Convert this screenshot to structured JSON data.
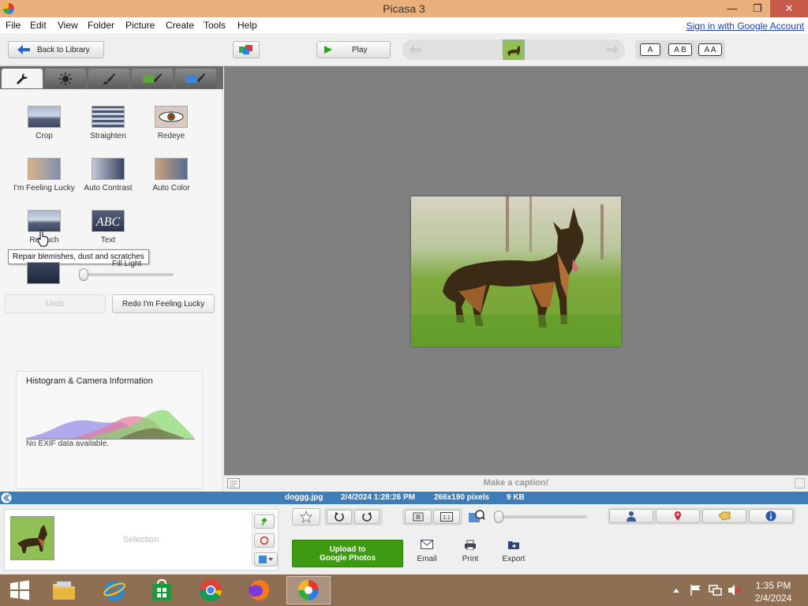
{
  "window": {
    "title": "Picasa 3",
    "minimize": "—",
    "restore": "❐",
    "close": "✕"
  },
  "menu": [
    "File",
    "Edit",
    "View",
    "Folder",
    "Picture",
    "Create",
    "Tools",
    "Help"
  ],
  "signin": "Sign in with Google Account",
  "toolbar": {
    "back_label": "Back to Library",
    "play_label": "Play",
    "font_buttons": [
      "A",
      "A B",
      "A A"
    ]
  },
  "tools": [
    {
      "label": "Crop"
    },
    {
      "label": "Straighten"
    },
    {
      "label": "Redeye"
    },
    {
      "label": "I'm Feeling Lucky"
    },
    {
      "label": "Auto Contrast"
    },
    {
      "label": "Auto Color"
    },
    {
      "label": "Retouch"
    },
    {
      "label": "Text"
    }
  ],
  "tooltip": "Repair blemishes, dust and scratches",
  "fill_light": {
    "label": "Fill Light",
    "value": 0
  },
  "buttons": {
    "undo": "Undo",
    "redo": "Redo I'm Feeling Lucky"
  },
  "histogram": {
    "title": "Histogram & Camera Information",
    "exif": "No EXIF data available."
  },
  "caption": {
    "placeholder": "Make a caption!"
  },
  "info": {
    "filename": "doggg.jpg",
    "datetime": "2/4/2024 1:28:26 PM",
    "dimensions": "266x190 pixels",
    "size": "9 KB"
  },
  "tray": {
    "selection": "Selection",
    "upload": "Upload to Google Photos",
    "email": "Email",
    "print": "Print",
    "export": "Export"
  },
  "clock": {
    "time": "1:35 PM",
    "date": "2/4/2024"
  },
  "colors": {
    "accent_blue": "#3e7db8",
    "upload_green": "#3e9a10",
    "titlebar": "#e9b07c"
  }
}
